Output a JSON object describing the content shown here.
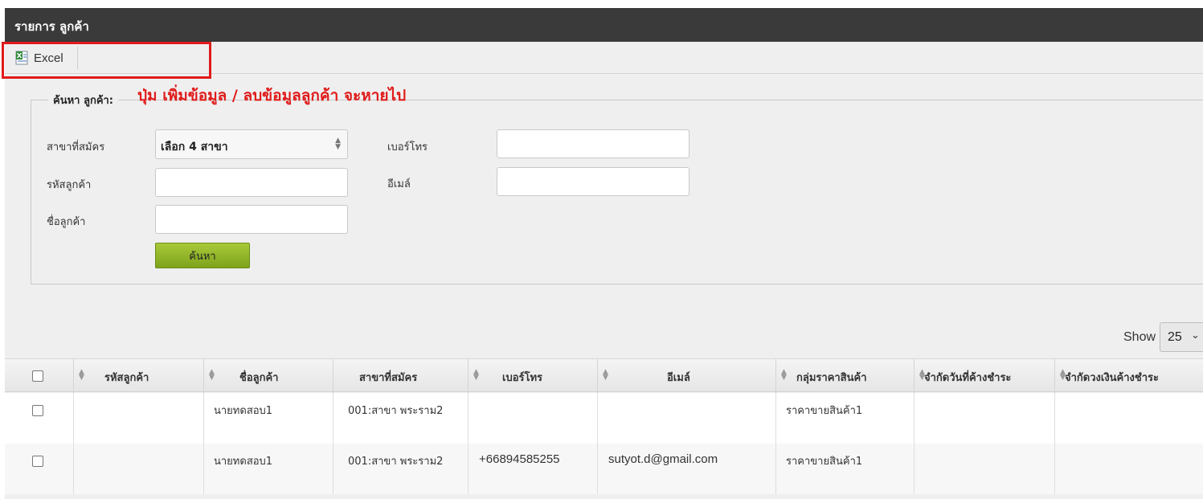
{
  "header": {
    "title": "รายการ ลูกค้า"
  },
  "toolbar": {
    "excel_label": "Excel"
  },
  "annotation": "ปุ่ม เพิ่มข้อมูล / ลบข้อมูลลูกค้า จะหายไป",
  "search": {
    "legend": "ค้นหา ลูกค้า:",
    "branch_label": "สาขาที่สมัคร",
    "branch_value": "เลือก 4 สาขา",
    "customer_code_label": "รหัสลูกค้า",
    "customer_code_value": "",
    "customer_name_label": "ชื่อลูกค้า",
    "customer_name_value": "",
    "phone_label": "เบอร์โทร",
    "phone_value": "",
    "email_label": "อีเมล์",
    "email_value": "",
    "search_button": "ค้นหา"
  },
  "pager": {
    "show_label": "Show",
    "page_size": "25"
  },
  "table": {
    "columns": [
      "รหัสลูกค้า",
      "ชื่อลูกค้า",
      "สาขาที่สมัคร",
      "เบอร์โทร",
      "อีเมล์",
      "กลุ่มราคาสินค้า",
      "จำกัดวันที่ค้างชำระ",
      "จำกัดวงเงินค้างชำระ"
    ],
    "rows": [
      {
        "code": "",
        "name": "นายทดสอบ1",
        "branch": "001:สาขา พระราม2",
        "phone": "",
        "email": "",
        "price_group": "ราคาขายสินค้า1",
        "credit_days": "",
        "credit_limit": ""
      },
      {
        "code": "",
        "name": "นายทดสอบ1",
        "branch": "001:สาขา พระราม2",
        "phone": "+66894585255",
        "email": "sutyot.d@gmail.com",
        "price_group": "ราคาขายสินค้า1",
        "credit_days": "",
        "credit_limit": ""
      }
    ]
  },
  "colors": {
    "title_bar": "#3a3a3a",
    "panel": "#efefef",
    "annotation": "#e01b1b",
    "search_button": "#8db326"
  }
}
